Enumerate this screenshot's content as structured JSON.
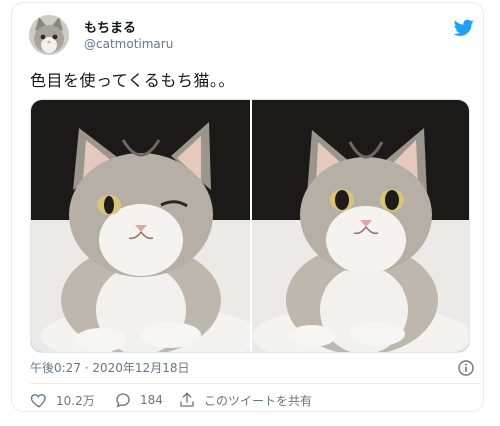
{
  "tweet": {
    "display_name": "もちまる",
    "handle": "@catmotimaru",
    "text": "色目を使ってくるもち猫。。",
    "timestamp": "午後0:27 · 2020年12月18日",
    "media": [
      {
        "icon": "cat-photo-winking"
      },
      {
        "icon": "cat-photo-staring"
      }
    ]
  },
  "actions": {
    "likes": "10.2万",
    "replies": "184",
    "share_label": "このツイートを共有"
  },
  "colors": {
    "brand": "#1da1f2",
    "text": "#14171a",
    "muted": "#657786",
    "border": "#e6ecf0"
  }
}
